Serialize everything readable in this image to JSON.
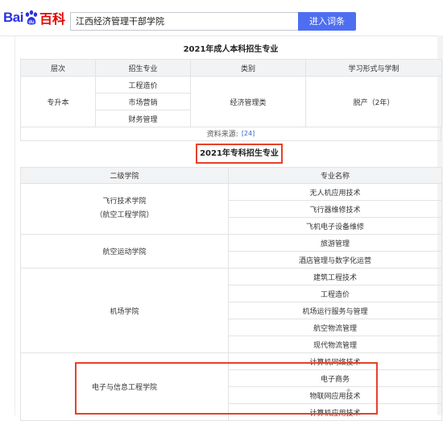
{
  "header": {
    "logo_left": "Bai",
    "logo_right": "百科",
    "search_value": "江西经济管理干部学院",
    "search_button": "进入词条"
  },
  "table1": {
    "caption": "2021年成人本科招生专业",
    "headers": [
      "层次",
      "招生专业",
      "类别",
      "学习形式与学制"
    ],
    "level": "专升本",
    "majors": [
      "工程造价",
      "市场营销",
      "财务管理"
    ],
    "category": "经济管理类",
    "mode": "脱产（2年）",
    "source_label": "资料来源:",
    "source_ref": "[24]"
  },
  "table2": {
    "caption": "2021年专科招生专业",
    "headers": [
      "二级学院",
      "专业名称"
    ],
    "groups": [
      {
        "college": "飞行技术学院",
        "college_sub": "（航空工程学院）",
        "majors": [
          "无人机应用技术",
          "飞行器维修技术",
          "飞机电子设备维修"
        ]
      },
      {
        "college": "航空运动学院",
        "majors": [
          "旅游管理",
          "酒店管理与数字化运营"
        ]
      },
      {
        "college": "机场学院",
        "majors": [
          "建筑工程技术",
          "工程造价",
          "机场运行服务与管理",
          "航空物流管理",
          "现代物流管理"
        ]
      },
      {
        "college": "电子与信息工程学院",
        "majors": [
          "计算机网络技术",
          "电子商务",
          "物联网应用技术",
          "计算机应用技术"
        ]
      }
    ]
  },
  "colors": {
    "accent": "#4e6ef2",
    "highlight": "#e8402a",
    "logo_blue": "#2932e1",
    "logo_red": "#e10602"
  }
}
